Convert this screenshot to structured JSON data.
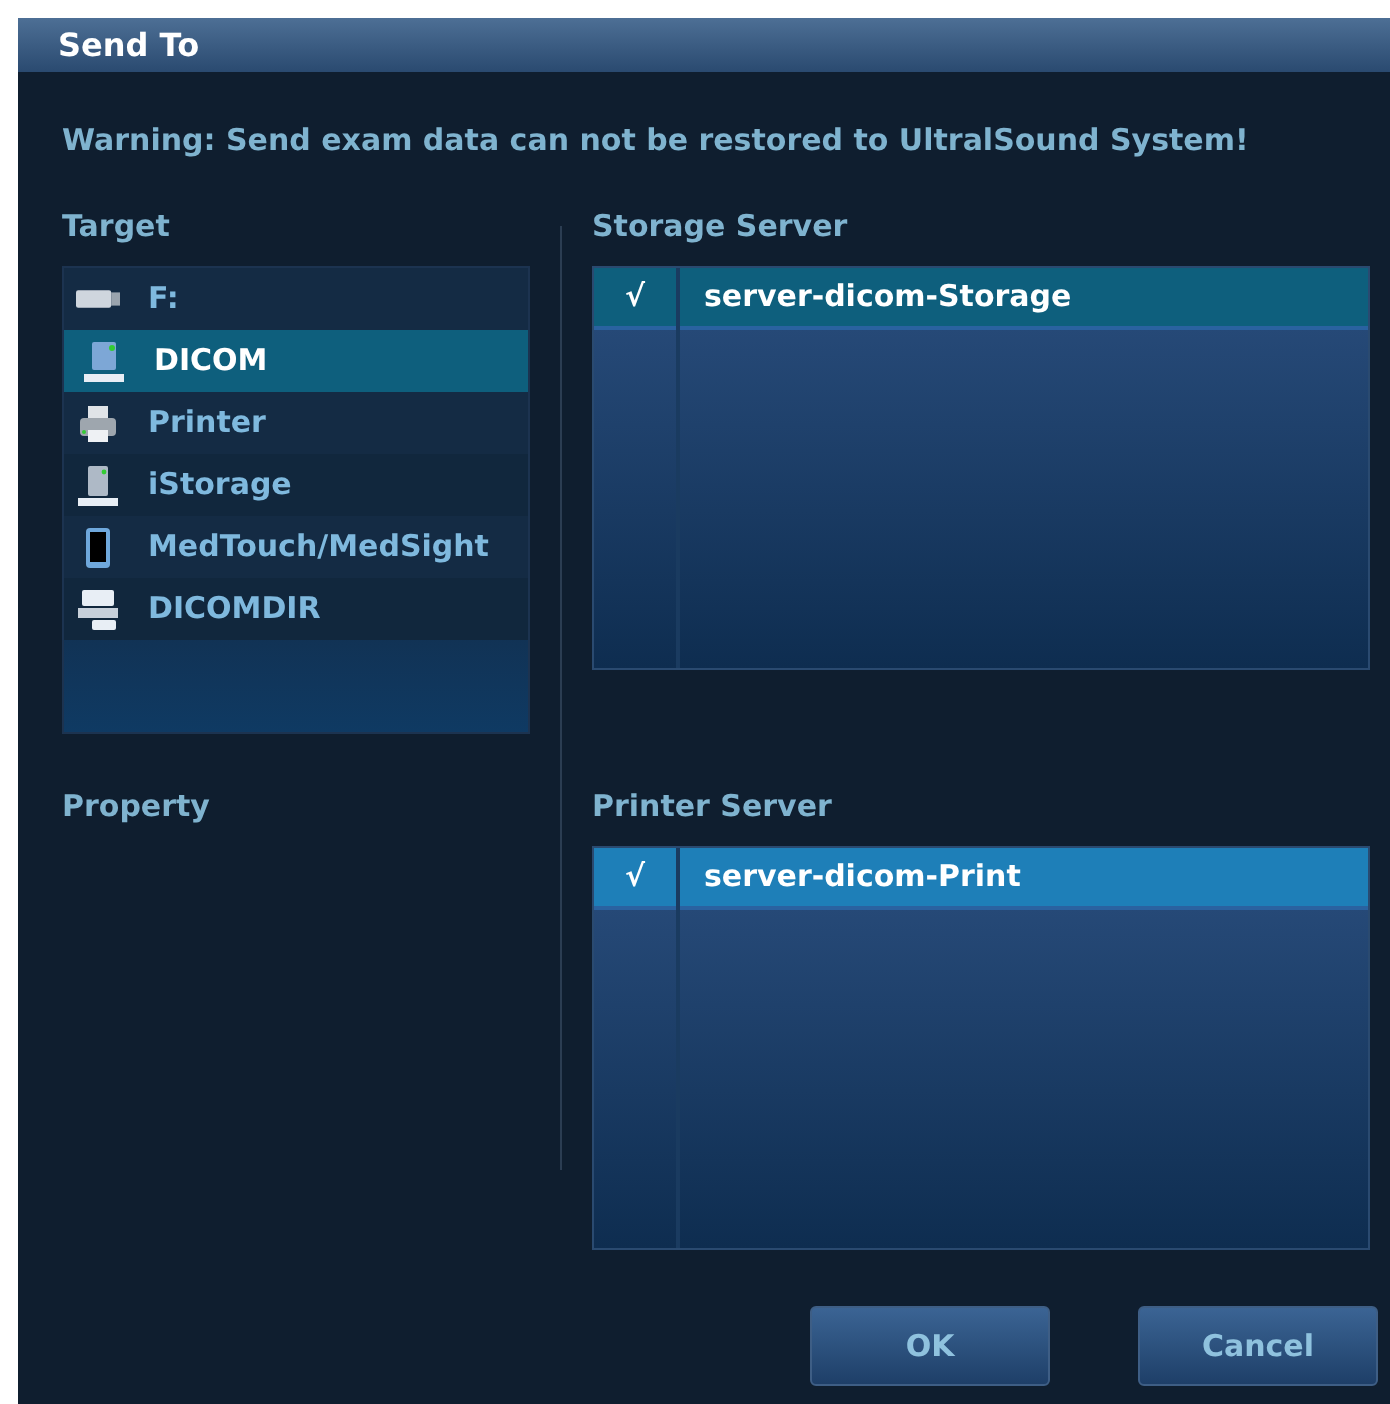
{
  "window": {
    "title": "Send To"
  },
  "warning": "Warning: Send exam data can not be restored to UltralSound System!",
  "target": {
    "label": "Target",
    "items": [
      {
        "kind": "usb",
        "label": "F:",
        "selected": false
      },
      {
        "kind": "dicom",
        "label": "DICOM",
        "selected": true
      },
      {
        "kind": "printer",
        "label": "Printer",
        "selected": false
      },
      {
        "kind": "istorage",
        "label": "iStorage",
        "selected": false
      },
      {
        "kind": "tablet",
        "label": "MedTouch/MedSight",
        "selected": false
      },
      {
        "kind": "dicomdir",
        "label": "DICOMDIR",
        "selected": false
      }
    ]
  },
  "property": {
    "label": "Property"
  },
  "storage_server": {
    "label": "Storage Server",
    "focused": false,
    "rows": [
      {
        "check": "√",
        "checked": true,
        "name": "server-dicom-Storage",
        "selected": true
      }
    ]
  },
  "printer_server": {
    "label": "Printer Server",
    "focused": true,
    "rows": [
      {
        "check": "√",
        "checked": true,
        "name": "server-dicom-Print",
        "selected": true
      }
    ]
  },
  "buttons": [
    "OK",
    "Cancel"
  ]
}
